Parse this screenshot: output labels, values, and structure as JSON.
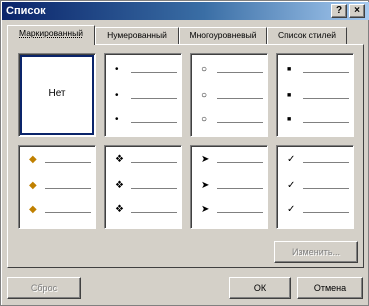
{
  "window": {
    "title": "Список"
  },
  "titlebar": {
    "help_glyph": "?",
    "close_glyph": "×"
  },
  "tabs": [
    {
      "label": "Маркированный",
      "active": true
    },
    {
      "label": "Нумерованный",
      "active": false
    },
    {
      "label": "Многоуровневый",
      "active": false
    },
    {
      "label": "Список стилей",
      "active": false
    }
  ],
  "gallery": {
    "none_label": "Нет",
    "bullet_sets": [
      {
        "icon": "none"
      },
      {
        "icon": "filled-circle",
        "glyph": "•"
      },
      {
        "icon": "hollow-circle",
        "glyph": "○"
      },
      {
        "icon": "filled-square",
        "glyph": "■"
      },
      {
        "icon": "picture-bullet",
        "glyph": "◆"
      },
      {
        "icon": "four-diamond",
        "glyph": "❖"
      },
      {
        "icon": "arrowhead",
        "glyph": "➤"
      },
      {
        "icon": "checkmark",
        "glyph": "✓"
      }
    ]
  },
  "buttons": {
    "customize": "Изменить...",
    "reset": "Сброс",
    "ok": "ОК",
    "cancel": "Отмена"
  }
}
